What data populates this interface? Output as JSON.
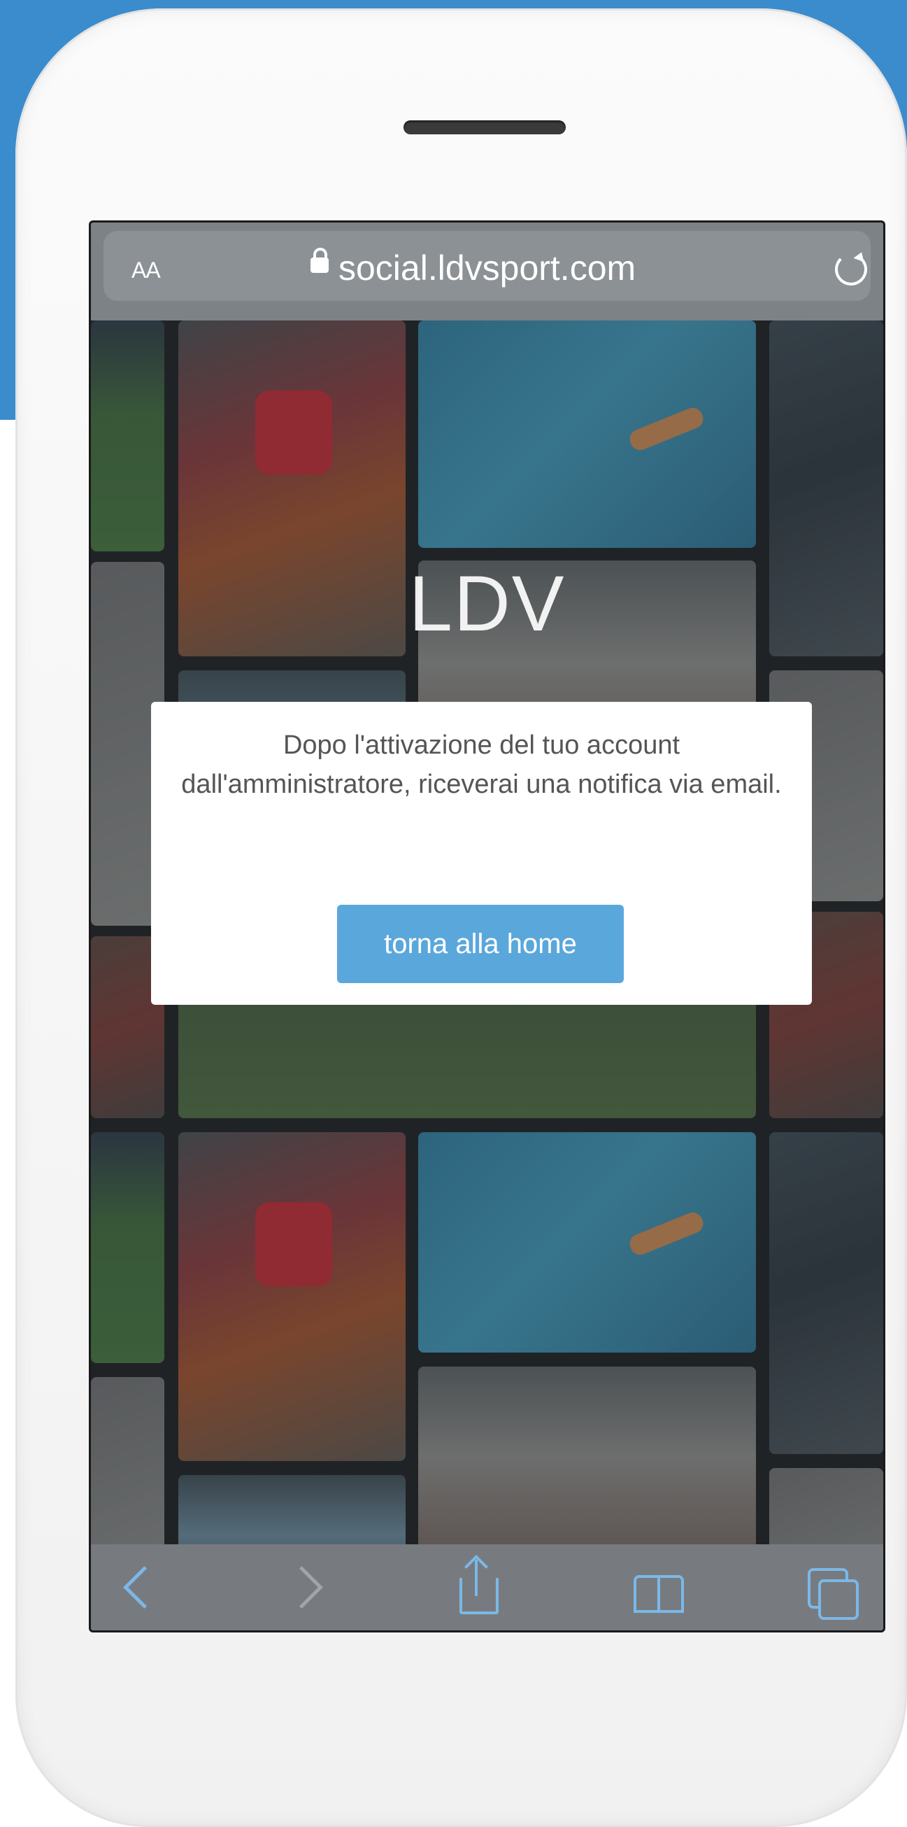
{
  "browser": {
    "text_size_label": "AA",
    "url": "social.ldvsport.com",
    "icons": {
      "lock": "lock-icon",
      "reload": "reload-icon"
    }
  },
  "page": {
    "brand": "LDV"
  },
  "dialog": {
    "message": "Dopo l'attivazione del tuo account dall'amministratore, riceverai una notifica via email.",
    "button_label": "torna alla home"
  },
  "toolbar": {
    "icons": [
      "back-icon",
      "forward-icon",
      "share-icon",
      "bookmarks-icon",
      "tabs-icon"
    ]
  },
  "colors": {
    "frame_accent": "#3b8ccd",
    "button": "#5aa7dc",
    "toolbar_icon": "#7bb8e8"
  }
}
